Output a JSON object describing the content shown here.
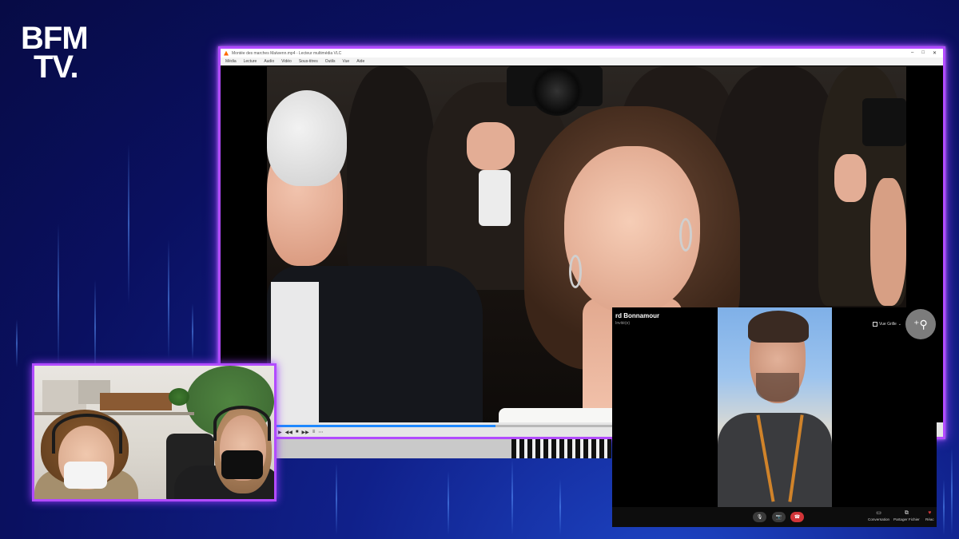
{
  "channel": {
    "logo_line1": "BFM",
    "logo_line2": "TV."
  },
  "vlc": {
    "title": "Montée des marches Maïwenn.mp4 - Lecteur multimédia VLC",
    "menu": [
      "Média",
      "Lecture",
      "Audio",
      "Vidéo",
      "Sous-titres",
      "Outils",
      "Vue",
      "Aide"
    ],
    "playback_progress": 0.48,
    "controls": [
      "▶",
      "◀◀",
      "■",
      "▶▶",
      "≡",
      "⋯"
    ]
  },
  "teams": {
    "participant_name": "rd Bonnamour",
    "participant_subtitle": "Invité(e)",
    "view_label": "Vue Grille",
    "toolbar": {
      "mic": "🎙",
      "camera": "📷",
      "hangup": "☎",
      "conversation": "Conversation",
      "share_file": "Partager Fichier",
      "react": "Réac"
    }
  },
  "colors": {
    "accent_border": "#b24bff",
    "background": "#0a1060",
    "hangup": "#d13438"
  }
}
